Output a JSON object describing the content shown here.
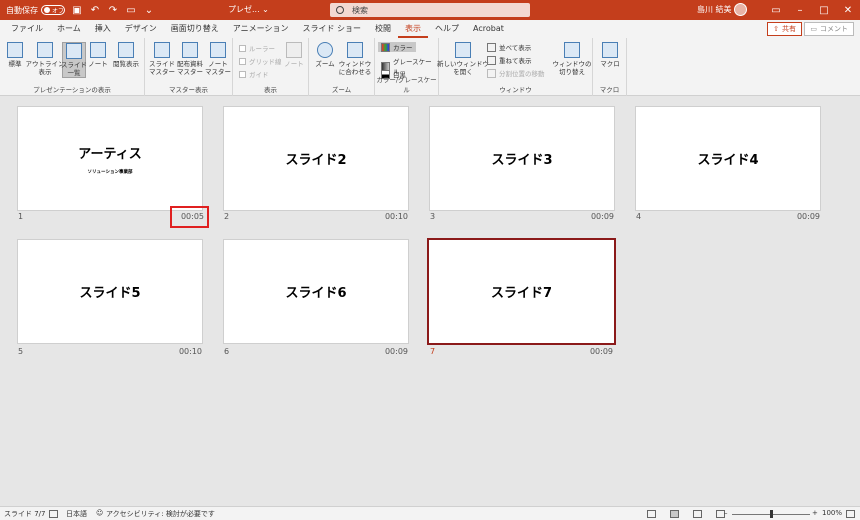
{
  "titlebar": {
    "autosave_label": "自動保存",
    "autosave_state": "オフ",
    "doc_title": "プレゼ... ⌄",
    "search_placeholder": "検索",
    "user_name": "島川 結美",
    "accent": "#c43e1c"
  },
  "menu": {
    "tabs": [
      "ファイル",
      "ホーム",
      "挿入",
      "デザイン",
      "画面切り替え",
      "アニメーション",
      "スライド ショー",
      "校閲",
      "表示",
      "ヘルプ",
      "Acrobat"
    ],
    "active_tab": "表示",
    "share_label": "共有",
    "comment_label": "コメント"
  },
  "ribbon": {
    "presentation_views": {
      "label": "プレゼンテーションの表示",
      "buttons": [
        "標準",
        "アウトライン\n表示",
        "スライド\n一覧",
        "ノート",
        "閲覧表示"
      ]
    },
    "master_views": {
      "label": "マスター表示",
      "buttons": [
        "スライド\nマスター",
        "配布資料\nマスター",
        "ノート\nマスター"
      ]
    },
    "show": {
      "label": "表示",
      "checks": [
        "ルーラー",
        "グリッド線",
        "ガイド"
      ],
      "note_label": "ノート"
    },
    "zoom": {
      "label": "ズーム",
      "buttons": [
        "ズーム",
        "ウィンドウ\nに合わせる"
      ]
    },
    "color": {
      "label": "カラー/グレースケール",
      "items": [
        "カラー",
        "グレースケール",
        "白黒"
      ]
    },
    "window": {
      "label": "ウィンドウ",
      "new_window": "新しいウィンドウ\nを開く",
      "items": [
        "並べて表示",
        "重ねて表示",
        "分割位置の移動"
      ],
      "switch": "ウィンドウの\n切り替え"
    },
    "macro": {
      "label": "マクロ",
      "button": "マクロ"
    }
  },
  "slides": [
    {
      "num": "1",
      "title": "アーティス",
      "subtitle": "ソリューション事業部",
      "time": "00:05"
    },
    {
      "num": "2",
      "title": "スライド2",
      "time": "00:10"
    },
    {
      "num": "3",
      "title": "スライド3",
      "time": "00:09"
    },
    {
      "num": "4",
      "title": "スライド4",
      "time": "00:09"
    },
    {
      "num": "5",
      "title": "スライド5",
      "time": "00:10"
    },
    {
      "num": "6",
      "title": "スライド6",
      "time": "00:09"
    },
    {
      "num": "7",
      "title": "スライド7",
      "time": "00:09"
    }
  ],
  "status": {
    "slide_counter": "スライド 7/7",
    "language": "日本語",
    "accessibility": "アクセシビリティ: 検討が必要です",
    "zoom": "100%"
  }
}
